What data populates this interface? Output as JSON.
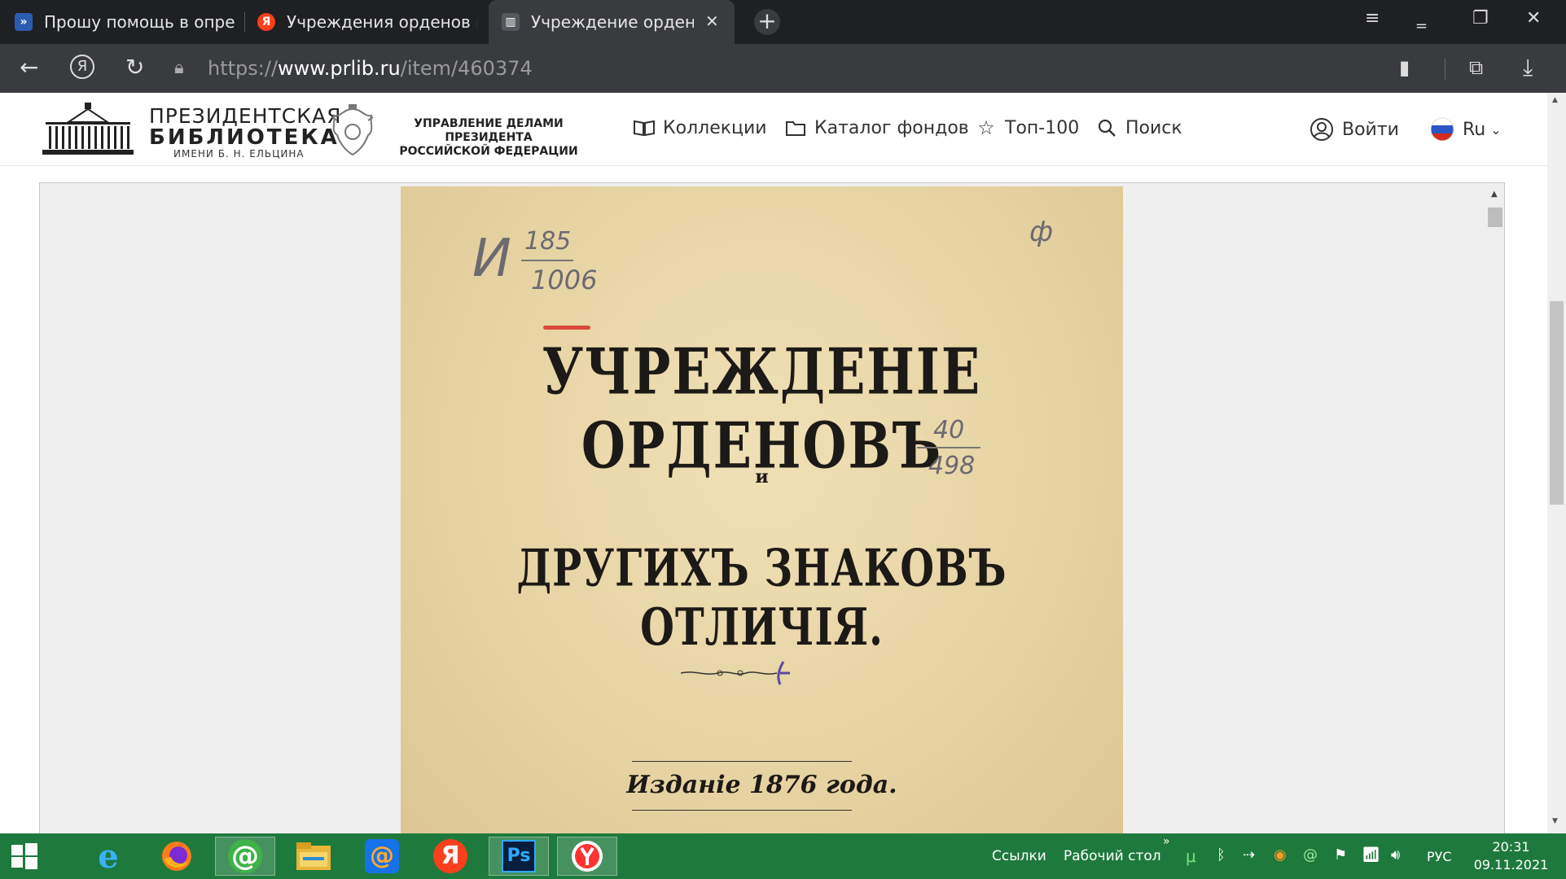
{
  "browser": {
    "tabs": [
      {
        "title": "Прошу помощь в определ",
        "favicon": "forum-icon"
      },
      {
        "title": "Учреждения орденов и др",
        "favicon": "yandex-icon"
      },
      {
        "title": "Учреждение орденов и",
        "favicon": "library-icon",
        "active": true
      }
    ],
    "url_scheme": "https://",
    "url_domain": "www.prlib.ru",
    "url_path": "/item/460374"
  },
  "site": {
    "logo_line1": "ПРЕЗИДЕНТСКАЯ",
    "logo_line2": "БИБЛИОТЕКА",
    "logo_line3": "ИМЕНИ Б. Н. ЕЛЬЦИНА",
    "admin_line1": "УПРАВЛЕНИЕ ДЕЛАМИ ПРЕЗИДЕНТА",
    "admin_line2": "РОССИЙСКОЙ ФЕДЕРАЦИИ",
    "nav": {
      "collections": "Коллекции",
      "catalog": "Каталог фондов",
      "top100": "Топ-100",
      "search": "Поиск",
      "login": "Войти",
      "lang": "Ru"
    }
  },
  "document": {
    "title_line1": "УЧРЕЖДЕНІЕ ОРДЕНОВЪ",
    "conjunction": "и",
    "title_line2": "ДРУГИХЪ ЗНАКОВЪ ОТЛИЧІЯ.",
    "edition": "Изданіе 1876 года.",
    "handwritten": {
      "left_letter": "И",
      "left_num_top": "185",
      "left_num_bottom": "1006",
      "right_num_top": "40",
      "right_num_bottom": "498",
      "corner": "ф"
    }
  },
  "taskbar": {
    "links_label": "Ссылки",
    "desktop_label": "Рабочий стол",
    "lang": "РУС",
    "time": "20:31",
    "date": "09.11.2021"
  }
}
